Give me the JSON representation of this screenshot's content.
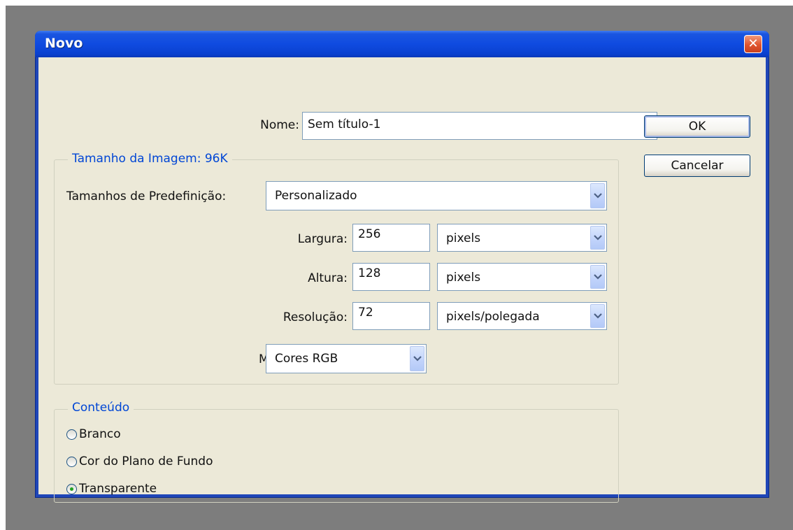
{
  "dialog": {
    "title": "Novo",
    "close_glyph": "✕",
    "name_label": "Nome:",
    "name_value": "Sem título-1",
    "ok_label": "OK",
    "cancel_label": "Cancelar"
  },
  "image_size": {
    "group_title": "Tamanho da Imagem: 96K",
    "preset_label": "Tamanhos de Predefinição:",
    "preset_value": "Personalizado",
    "width_label": "Largura:",
    "width_value": "256",
    "width_unit": "pixels",
    "height_label": "Altura:",
    "height_value": "128",
    "height_unit": "pixels",
    "resolution_label": "Resolução:",
    "resolution_value": "72",
    "resolution_unit": "pixels/polegada",
    "mode_label": "Modo:",
    "mode_value": "Cores RGB"
  },
  "content": {
    "group_title": "Conteúdo",
    "options": [
      {
        "label": "Branco",
        "selected": false
      },
      {
        "label": "Cor do Plano de Fundo",
        "selected": false
      },
      {
        "label": "Transparente",
        "selected": true
      }
    ]
  },
  "icons": {
    "close": "close-icon",
    "dropdown": "chevron-down-icon",
    "radio": "radio-icon"
  },
  "colors": {
    "titlebar": "#0f4be0",
    "dialog_face": "#ece9d8",
    "group_title_text": "#0046d5",
    "close_button": "#e0542d"
  }
}
